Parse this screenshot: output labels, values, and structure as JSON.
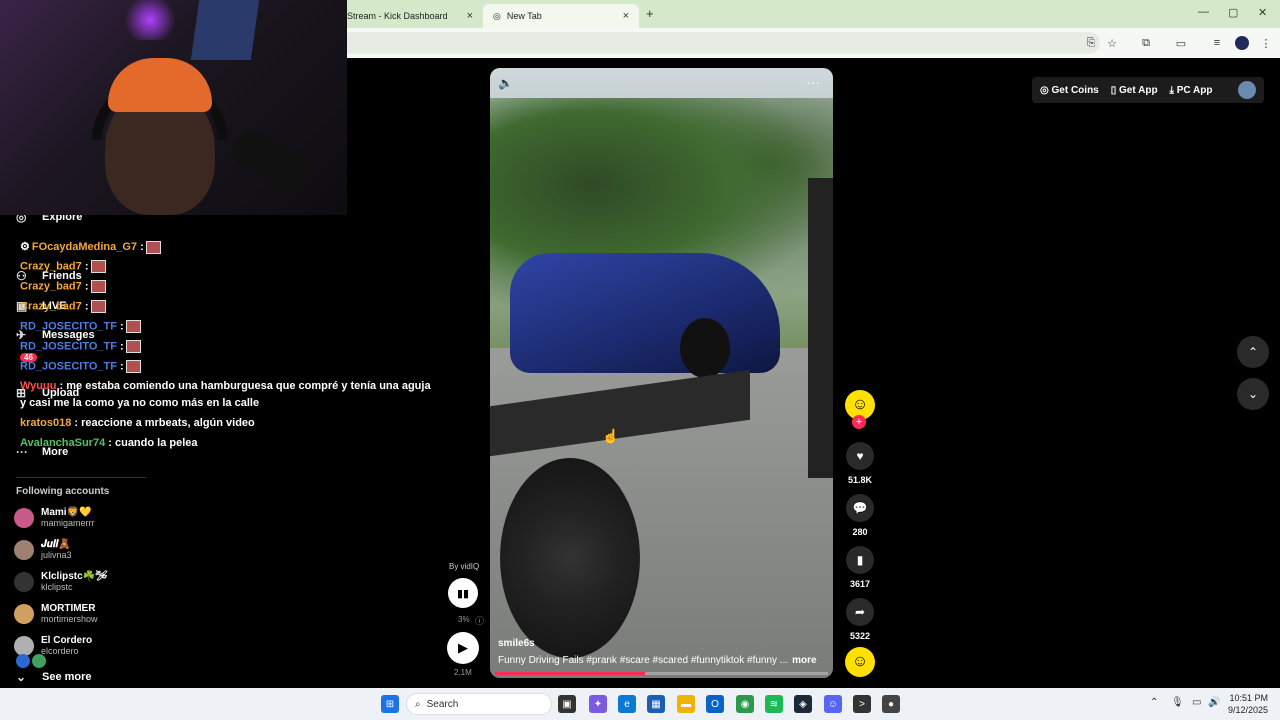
{
  "browser": {
    "tabs": [
      {
        "label": "Stream - Kick Dashboard"
      },
      {
        "label": "New Tab"
      }
    ],
    "new_tab_symbol": "+",
    "close_symbol": "×",
    "window_controls": {
      "minimize": "—",
      "maximize": "▢",
      "close": "✕"
    }
  },
  "nav": {
    "items": [
      {
        "label": "Explore",
        "icon": "compass-icon"
      },
      {
        "label": "Friends",
        "icon": "friends-icon"
      },
      {
        "label": "LIVE",
        "icon": "live-icon"
      },
      {
        "label": "Messages",
        "icon": "messages-icon"
      },
      {
        "label": "Upload",
        "icon": "upload-icon"
      },
      {
        "label": "More",
        "icon": "more-icon"
      }
    ],
    "messages_badge": "46"
  },
  "chat": [
    {
      "user": "FOcaydaMedina_G7",
      "text": " :",
      "emote": true
    },
    {
      "user": "Crazy_bad7",
      "text": " :",
      "emote": true
    },
    {
      "user": "Crazy_bad7",
      "text": " :",
      "emote": true
    },
    {
      "user": "Crazy_bad7",
      "text": " :",
      "emote": true
    },
    {
      "user": "RD_JOSECITO_TF",
      "text": " :",
      "emote": true
    },
    {
      "user": "RD_JOSECITO_TF",
      "text": " :",
      "emote": true
    },
    {
      "user": "RD_JOSECITO_TF",
      "text": " :",
      "emote": true
    },
    {
      "user": "Wyuuu",
      "text": " : me estaba comiendo una hamburguesa que compré y tenía una aguja"
    },
    {
      "user": "",
      "text": "y casi me la como ya no como más en la calle"
    },
    {
      "user": "kratos018",
      "text": " : reaccione a mrbeats, algún video"
    },
    {
      "user": "AvalanchaSur74",
      "text": " : cuando la pelea"
    }
  ],
  "following": {
    "title": "Following accounts",
    "accounts": [
      {
        "name": "Mami🦁💛",
        "handle": "mamigamerrr",
        "color": "#c85a8a"
      },
      {
        "name": "𝑱𝒖𝒍𝒊🧸",
        "handle": "julivna3",
        "color": "#a08070"
      },
      {
        "name": "Klclipstc☘️🛩",
        "handle": "klclipstc",
        "color": "#333333"
      },
      {
        "name": "MORTIMER",
        "handle": "mortimershow",
        "color": "#d0a060"
      },
      {
        "name": "El Cordero",
        "handle": "elcordero",
        "color": "#b0b0b0"
      }
    ],
    "see_more": "See more"
  },
  "video": {
    "username": "smile6s",
    "caption": "Funny Driving Fails #prank #scare #scared #funnytiktok #funny ...",
    "more_label": "more",
    "progress": 0.45
  },
  "actions": {
    "likes": "51.8K",
    "comments": "280",
    "saves": "3617",
    "shares": "5322"
  },
  "top_right": {
    "get_coins": "Get Coins",
    "get_app": "Get App",
    "pc_app": "PC App"
  },
  "vidiq": {
    "by": "By vidIQ",
    "percent": "3%",
    "plays": "2.1M"
  },
  "taskbar": {
    "search_placeholder": "Search",
    "time": "10:51 PM",
    "date": "9/12/2025"
  },
  "colors": {
    "tab_bar": "#d3e9c9",
    "accent": "#fe2c55",
    "smiley": "#ffe000"
  }
}
